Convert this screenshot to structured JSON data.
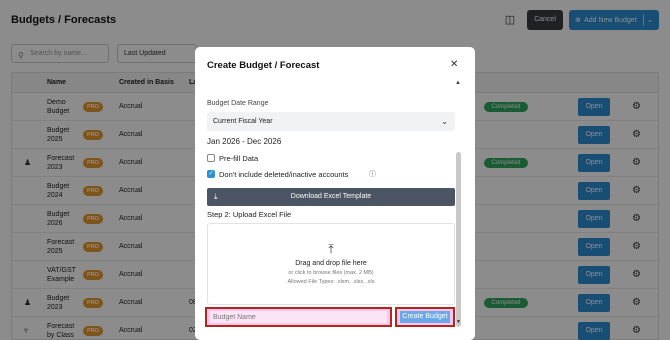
{
  "page": {
    "title": "Budgets / Forecasts",
    "cancel_label": "Cancel",
    "add_label": "Add New Budget",
    "search_placeholder": "Search by name...",
    "sort_value": "Last Updated"
  },
  "table": {
    "headers": [
      "Name",
      "Created in Basis",
      "La"
    ],
    "rows": [
      {
        "name": "Demo Budget",
        "pro": "PRO",
        "basis": "Accrual",
        "last": "",
        "status": "Completed",
        "open": "Open"
      },
      {
        "name": "Budget 2025",
        "pro": "PRO",
        "basis": "Accrual",
        "last": "",
        "status": "",
        "open": "Open"
      },
      {
        "name": "Forecast 2023",
        "pro": "PRO",
        "basis": "Accrual",
        "last": "",
        "status": "Completed",
        "open": "Open"
      },
      {
        "name": "Budget 2024",
        "pro": "PRO",
        "basis": "Accrual",
        "last": "",
        "status": "",
        "open": "Open"
      },
      {
        "name": "Budget 2026",
        "pro": "PRO",
        "basis": "Accrual",
        "last": "",
        "status": "",
        "open": "Open"
      },
      {
        "name": "Forecast 2025",
        "pro": "PRO",
        "basis": "Accrual",
        "last": "",
        "status": "",
        "open": "Open"
      },
      {
        "name": "VAT/GST Example",
        "pro": "PRO",
        "basis": "Accrual",
        "last": "",
        "status": "",
        "open": "Open"
      },
      {
        "name": "Budget 2023",
        "pro": "PRO",
        "basis": "Accrual",
        "last": "08",
        "status": "Completed",
        "open": "Open"
      },
      {
        "name": "Forecast by Class",
        "pro": "PRO",
        "basis": "Accrual",
        "last": "02",
        "status": "",
        "open": "Open"
      }
    ]
  },
  "modal": {
    "title": "Create Budget / Forecast",
    "date_range_label": "Budget Date Range",
    "date_range_value": "Current Fiscal Year",
    "range_text": "Jan 2026 - Dec 2026",
    "prefill_label": "Pre-fill Data",
    "exclude_label": "Don't include deleted/inactive accounts",
    "download_label": "Download Excel Template",
    "step2_label": "Step 2: Upload Excel File",
    "drop_title": "Drag and drop file here",
    "drop_hint": "or click to browse files (max. 2 MB)",
    "drop_types": "Allowed File Types: .xlsm, .xlsx, .xls",
    "name_placeholder": "Budget Name",
    "create_label": "Create Budget"
  },
  "colors": {
    "primary": "#2f8fd4",
    "pro": "#e89a2c",
    "completed": "#2fa65b",
    "highlight": "#b3261e"
  }
}
